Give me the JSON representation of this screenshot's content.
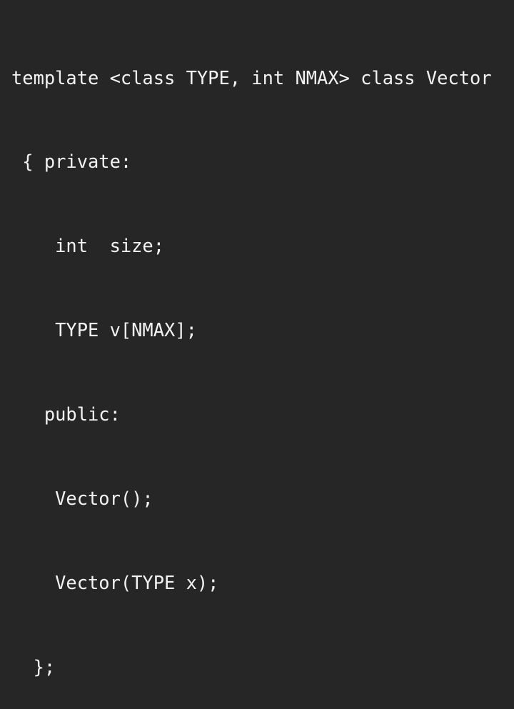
{
  "code_lines": [
    "template <class TYPE, int NMAX> class Vector",
    " { private:",
    "    int  size;",
    "    TYPE v[NMAX];",
    "   public:",
    "    Vector();",
    "    Vector(TYPE x);",
    "  };"
  ],
  "colors": {
    "background": "#262626",
    "text": "#f2f2f2"
  }
}
